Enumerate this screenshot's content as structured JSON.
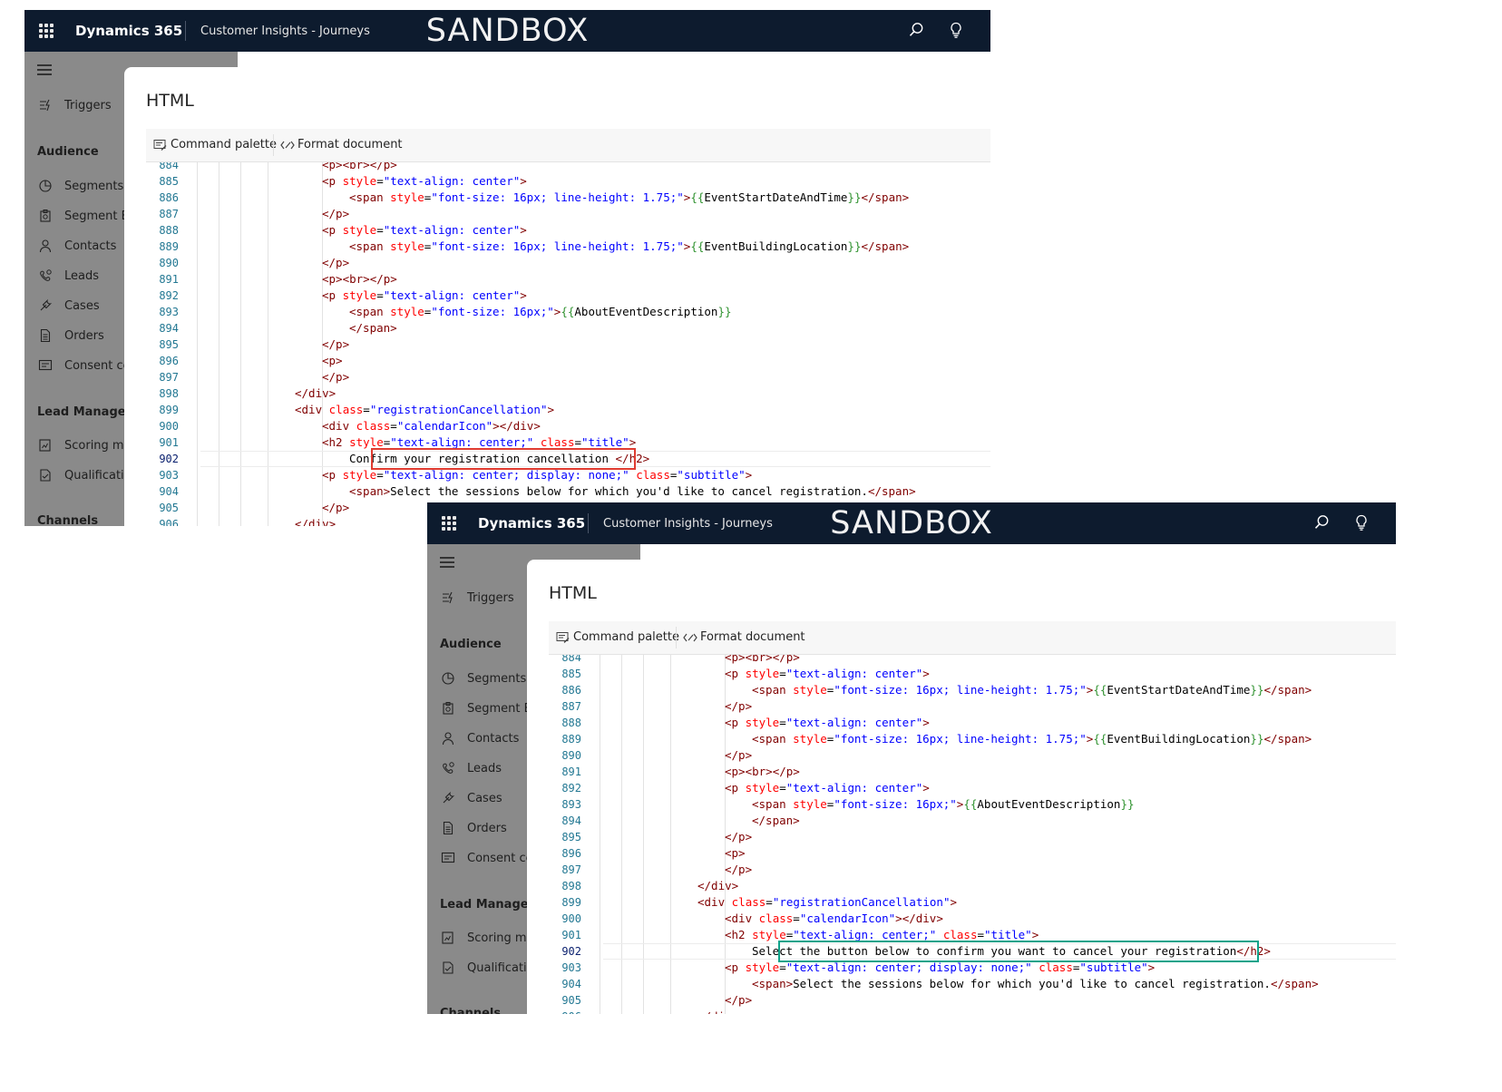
{
  "app": {
    "name": "Dynamics 365",
    "module": "Customer Insights - Journeys",
    "environment_banner": "SANDBOX"
  },
  "header_icons": [
    "search-icon",
    "lightbulb-icon"
  ],
  "sidebar": {
    "items": [
      {
        "type": "item",
        "label": "Triggers",
        "icon": "trigger-icon"
      },
      {
        "type": "heading",
        "label": "Audience"
      },
      {
        "type": "item",
        "label": "Segments",
        "icon": "segments-icon"
      },
      {
        "type": "item",
        "label": "Segment Ex",
        "icon": "segment-export-icon"
      },
      {
        "type": "item",
        "label": "Contacts",
        "icon": "person-icon"
      },
      {
        "type": "item",
        "label": "Leads",
        "icon": "leads-icon"
      },
      {
        "type": "item",
        "label": "Cases",
        "icon": "wrench-icon"
      },
      {
        "type": "item",
        "label": "Orders",
        "icon": "document-icon"
      },
      {
        "type": "item",
        "label": "Consent ce",
        "icon": "consent-icon"
      },
      {
        "type": "heading",
        "label": "Lead Manageme"
      },
      {
        "type": "item",
        "label": "Scoring mo",
        "icon": "scoring-icon"
      },
      {
        "type": "item",
        "label": "Qualificatio",
        "icon": "qualification-icon"
      },
      {
        "type": "heading",
        "label": "Channels"
      }
    ]
  },
  "dialog": {
    "title": "HTML",
    "commands": {
      "command_palette": "Command palette",
      "format_document": "Format document"
    }
  },
  "colors": {
    "header_bg": "#0d1b2e",
    "before_highlight": "#e03c31",
    "after_highlight": "#0fa38a"
  },
  "editor": {
    "active_line": "902",
    "lines_before": [
      {
        "n": "884",
        "indent": 3,
        "code": [
          [
            "t-tag",
            "<p>"
          ],
          [
            "t-tag",
            "<br>"
          ],
          [
            "t-tag",
            "</p>"
          ]
        ]
      },
      {
        "n": "885",
        "indent": 3,
        "code": [
          [
            "t-tag",
            "<p "
          ],
          [
            "t-attr",
            "style"
          ],
          [
            "",
            "="
          ],
          [
            "t-val",
            "\"text-align: center\""
          ],
          [
            "t-tag",
            ">"
          ]
        ]
      },
      {
        "n": "886",
        "indent": 4,
        "code": [
          [
            "t-tag",
            "<span "
          ],
          [
            "t-attr",
            "style"
          ],
          [
            "",
            "="
          ],
          [
            "t-val",
            "\"font-size: 16px; line-height: 1.75;\""
          ],
          [
            "t-tag",
            ">"
          ],
          [
            "t-brk",
            "{{"
          ],
          [
            "",
            "EventStartDateAndTime"
          ],
          [
            "t-brk",
            "}}"
          ],
          [
            "t-tag",
            "</span>"
          ]
        ]
      },
      {
        "n": "887",
        "indent": 3,
        "code": [
          [
            "t-tag",
            "</p>"
          ]
        ]
      },
      {
        "n": "888",
        "indent": 3,
        "code": [
          [
            "t-tag",
            "<p "
          ],
          [
            "t-attr",
            "style"
          ],
          [
            "",
            "="
          ],
          [
            "t-val",
            "\"text-align: center\""
          ],
          [
            "t-tag",
            ">"
          ]
        ]
      },
      {
        "n": "889",
        "indent": 4,
        "code": [
          [
            "t-tag",
            "<span "
          ],
          [
            "t-attr",
            "style"
          ],
          [
            "",
            "="
          ],
          [
            "t-val",
            "\"font-size: 16px; line-height: 1.75;\""
          ],
          [
            "t-tag",
            ">"
          ],
          [
            "t-brk",
            "{{"
          ],
          [
            "",
            "EventBuildingLocation"
          ],
          [
            "t-brk",
            "}}"
          ],
          [
            "t-tag",
            "</span>"
          ]
        ]
      },
      {
        "n": "890",
        "indent": 3,
        "code": [
          [
            "t-tag",
            "</p>"
          ]
        ]
      },
      {
        "n": "891",
        "indent": 3,
        "code": [
          [
            "t-tag",
            "<p>"
          ],
          [
            "t-tag",
            "<br>"
          ],
          [
            "t-tag",
            "</p>"
          ]
        ]
      },
      {
        "n": "892",
        "indent": 3,
        "code": [
          [
            "t-tag",
            "<p "
          ],
          [
            "t-attr",
            "style"
          ],
          [
            "",
            "="
          ],
          [
            "t-val",
            "\"text-align: center\""
          ],
          [
            "t-tag",
            ">"
          ]
        ]
      },
      {
        "n": "893",
        "indent": 4,
        "code": [
          [
            "t-tag",
            "<span "
          ],
          [
            "t-attr",
            "style"
          ],
          [
            "",
            "="
          ],
          [
            "t-val",
            "\"font-size: 16px;\""
          ],
          [
            "t-tag",
            ">"
          ],
          [
            "t-brk",
            "{{"
          ],
          [
            "",
            "AboutEventDescription"
          ],
          [
            "t-brk",
            "}}"
          ]
        ]
      },
      {
        "n": "894",
        "indent": 4,
        "code": [
          [
            "t-tag",
            "</span>"
          ]
        ]
      },
      {
        "n": "895",
        "indent": 3,
        "code": [
          [
            "t-tag",
            "</p>"
          ]
        ]
      },
      {
        "n": "896",
        "indent": 3,
        "code": [
          [
            "t-tag",
            "<p>"
          ]
        ]
      },
      {
        "n": "897",
        "indent": 3,
        "code": [
          [
            "t-tag",
            "</p>"
          ]
        ]
      },
      {
        "n": "898",
        "indent": 2,
        "code": [
          [
            "t-tag",
            "</div>"
          ]
        ]
      },
      {
        "n": "899",
        "indent": 2,
        "code": [
          [
            "t-tag",
            "<div "
          ],
          [
            "t-attr",
            "class"
          ],
          [
            "",
            "="
          ],
          [
            "t-val",
            "\"registrationCancellation\""
          ],
          [
            "t-tag",
            ">"
          ]
        ]
      },
      {
        "n": "900",
        "indent": 3,
        "code": [
          [
            "t-tag",
            "<div "
          ],
          [
            "t-attr",
            "class"
          ],
          [
            "",
            "="
          ],
          [
            "t-val",
            "\"calendarIcon\""
          ],
          [
            "t-tag",
            ">"
          ],
          [
            "t-tag",
            "</div>"
          ]
        ]
      },
      {
        "n": "901",
        "indent": 3,
        "code": [
          [
            "t-tag",
            "<h2 "
          ],
          [
            "t-attr",
            "style"
          ],
          [
            "",
            "="
          ],
          [
            "t-val",
            "\"text-align: center;\""
          ],
          [
            "",
            " "
          ],
          [
            "t-attr",
            "class"
          ],
          [
            "",
            "="
          ],
          [
            "t-val",
            "\"title\""
          ],
          [
            "t-tag",
            ">"
          ]
        ]
      },
      {
        "n": "902",
        "indent": 4,
        "code": [
          [
            "",
            "Confirm your registration cancellation"
          ],
          [
            "",
            " "
          ],
          [
            "t-tag",
            "</h2>"
          ]
        ]
      },
      {
        "n": "903",
        "indent": 3,
        "code": [
          [
            "t-tag",
            "<p "
          ],
          [
            "t-attr",
            "style"
          ],
          [
            "",
            "="
          ],
          [
            "t-val",
            "\"text-align: center; display: none;\""
          ],
          [
            "",
            " "
          ],
          [
            "t-attr",
            "class"
          ],
          [
            "",
            "="
          ],
          [
            "t-val",
            "\"subtitle\""
          ],
          [
            "t-tag",
            ">"
          ]
        ]
      },
      {
        "n": "904",
        "indent": 4,
        "code": [
          [
            "t-tag",
            "<span>"
          ],
          [
            "",
            "Select the sessions below for which you'd like to cancel registration."
          ],
          [
            "t-tag",
            "</span>"
          ]
        ]
      },
      {
        "n": "905",
        "indent": 3,
        "code": [
          [
            "t-tag",
            "</p>"
          ]
        ]
      },
      {
        "n": "906",
        "indent": 2,
        "code": [
          [
            "t-tag",
            "</div>"
          ]
        ]
      }
    ],
    "lines_after": [
      {
        "n": "884",
        "indent": 3,
        "code": [
          [
            "t-tag",
            "<p>"
          ],
          [
            "t-tag",
            "<br>"
          ],
          [
            "t-tag",
            "</p>"
          ]
        ]
      },
      {
        "n": "885",
        "indent": 3,
        "code": [
          [
            "t-tag",
            "<p "
          ],
          [
            "t-attr",
            "style"
          ],
          [
            "",
            "="
          ],
          [
            "t-val",
            "\"text-align: center\""
          ],
          [
            "t-tag",
            ">"
          ]
        ]
      },
      {
        "n": "886",
        "indent": 4,
        "code": [
          [
            "t-tag",
            "<span "
          ],
          [
            "t-attr",
            "style"
          ],
          [
            "",
            "="
          ],
          [
            "t-val",
            "\"font-size: 16px; line-height: 1.75;\""
          ],
          [
            "t-tag",
            ">"
          ],
          [
            "t-brk",
            "{{"
          ],
          [
            "",
            "EventStartDateAndTime"
          ],
          [
            "t-brk",
            "}}"
          ],
          [
            "t-tag",
            "</span>"
          ]
        ]
      },
      {
        "n": "887",
        "indent": 3,
        "code": [
          [
            "t-tag",
            "</p>"
          ]
        ]
      },
      {
        "n": "888",
        "indent": 3,
        "code": [
          [
            "t-tag",
            "<p "
          ],
          [
            "t-attr",
            "style"
          ],
          [
            "",
            "="
          ],
          [
            "t-val",
            "\"text-align: center\""
          ],
          [
            "t-tag",
            ">"
          ]
        ]
      },
      {
        "n": "889",
        "indent": 4,
        "code": [
          [
            "t-tag",
            "<span "
          ],
          [
            "t-attr",
            "style"
          ],
          [
            "",
            "="
          ],
          [
            "t-val",
            "\"font-size: 16px; line-height: 1.75;\""
          ],
          [
            "t-tag",
            ">"
          ],
          [
            "t-brk",
            "{{"
          ],
          [
            "",
            "EventBuildingLocation"
          ],
          [
            "t-brk",
            "}}"
          ],
          [
            "t-tag",
            "</span>"
          ]
        ]
      },
      {
        "n": "890",
        "indent": 3,
        "code": [
          [
            "t-tag",
            "</p>"
          ]
        ]
      },
      {
        "n": "891",
        "indent": 3,
        "code": [
          [
            "t-tag",
            "<p>"
          ],
          [
            "t-tag",
            "<br>"
          ],
          [
            "t-tag",
            "</p>"
          ]
        ]
      },
      {
        "n": "892",
        "indent": 3,
        "code": [
          [
            "t-tag",
            "<p "
          ],
          [
            "t-attr",
            "style"
          ],
          [
            "",
            "="
          ],
          [
            "t-val",
            "\"text-align: center\""
          ],
          [
            "t-tag",
            ">"
          ]
        ]
      },
      {
        "n": "893",
        "indent": 4,
        "code": [
          [
            "t-tag",
            "<span "
          ],
          [
            "t-attr",
            "style"
          ],
          [
            "",
            "="
          ],
          [
            "t-val",
            "\"font-size: 16px;\""
          ],
          [
            "t-tag",
            ">"
          ],
          [
            "t-brk",
            "{{"
          ],
          [
            "",
            "AboutEventDescription"
          ],
          [
            "t-brk",
            "}}"
          ]
        ]
      },
      {
        "n": "894",
        "indent": 4,
        "code": [
          [
            "t-tag",
            "</span>"
          ]
        ]
      },
      {
        "n": "895",
        "indent": 3,
        "code": [
          [
            "t-tag",
            "</p>"
          ]
        ]
      },
      {
        "n": "896",
        "indent": 3,
        "code": [
          [
            "t-tag",
            "<p>"
          ]
        ]
      },
      {
        "n": "897",
        "indent": 3,
        "code": [
          [
            "t-tag",
            "</p>"
          ]
        ]
      },
      {
        "n": "898",
        "indent": 2,
        "code": [
          [
            "t-tag",
            "</div>"
          ]
        ]
      },
      {
        "n": "899",
        "indent": 2,
        "code": [
          [
            "t-tag",
            "<div "
          ],
          [
            "t-attr",
            "class"
          ],
          [
            "",
            "="
          ],
          [
            "t-val",
            "\"registrationCancellation\""
          ],
          [
            "t-tag",
            ">"
          ]
        ]
      },
      {
        "n": "900",
        "indent": 3,
        "code": [
          [
            "t-tag",
            "<div "
          ],
          [
            "t-attr",
            "class"
          ],
          [
            "",
            "="
          ],
          [
            "t-val",
            "\"calendarIcon\""
          ],
          [
            "t-tag",
            ">"
          ],
          [
            "t-tag",
            "</div>"
          ]
        ]
      },
      {
        "n": "901",
        "indent": 3,
        "code": [
          [
            "t-tag",
            "<h2 "
          ],
          [
            "t-attr",
            "style"
          ],
          [
            "",
            "="
          ],
          [
            "t-val",
            "\"text-align: center;\""
          ],
          [
            "",
            " "
          ],
          [
            "t-attr",
            "class"
          ],
          [
            "",
            "="
          ],
          [
            "t-val",
            "\"title\""
          ],
          [
            "t-tag",
            ">"
          ]
        ]
      },
      {
        "n": "902",
        "indent": 4,
        "code": [
          [
            "",
            "Select the button below to confirm you want to cancel your registration"
          ],
          [
            "t-tag",
            "</h2>"
          ]
        ]
      },
      {
        "n": "903",
        "indent": 3,
        "code": [
          [
            "t-tag",
            "<p "
          ],
          [
            "t-attr",
            "style"
          ],
          [
            "",
            "="
          ],
          [
            "t-val",
            "\"text-align: center; display: none;\""
          ],
          [
            "",
            " "
          ],
          [
            "t-attr",
            "class"
          ],
          [
            "",
            "="
          ],
          [
            "t-val",
            "\"subtitle\""
          ],
          [
            "t-tag",
            ">"
          ]
        ]
      },
      {
        "n": "904",
        "indent": 4,
        "code": [
          [
            "t-tag",
            "<span>"
          ],
          [
            "",
            "Select the sessions below for which you'd like to cancel registration."
          ],
          [
            "t-tag",
            "</span>"
          ]
        ]
      },
      {
        "n": "905",
        "indent": 3,
        "code": [
          [
            "t-tag",
            "</p>"
          ]
        ]
      },
      {
        "n": "906",
        "indent": 2,
        "code": [
          [
            "t-tag",
            "</div>"
          ]
        ]
      }
    ]
  }
}
